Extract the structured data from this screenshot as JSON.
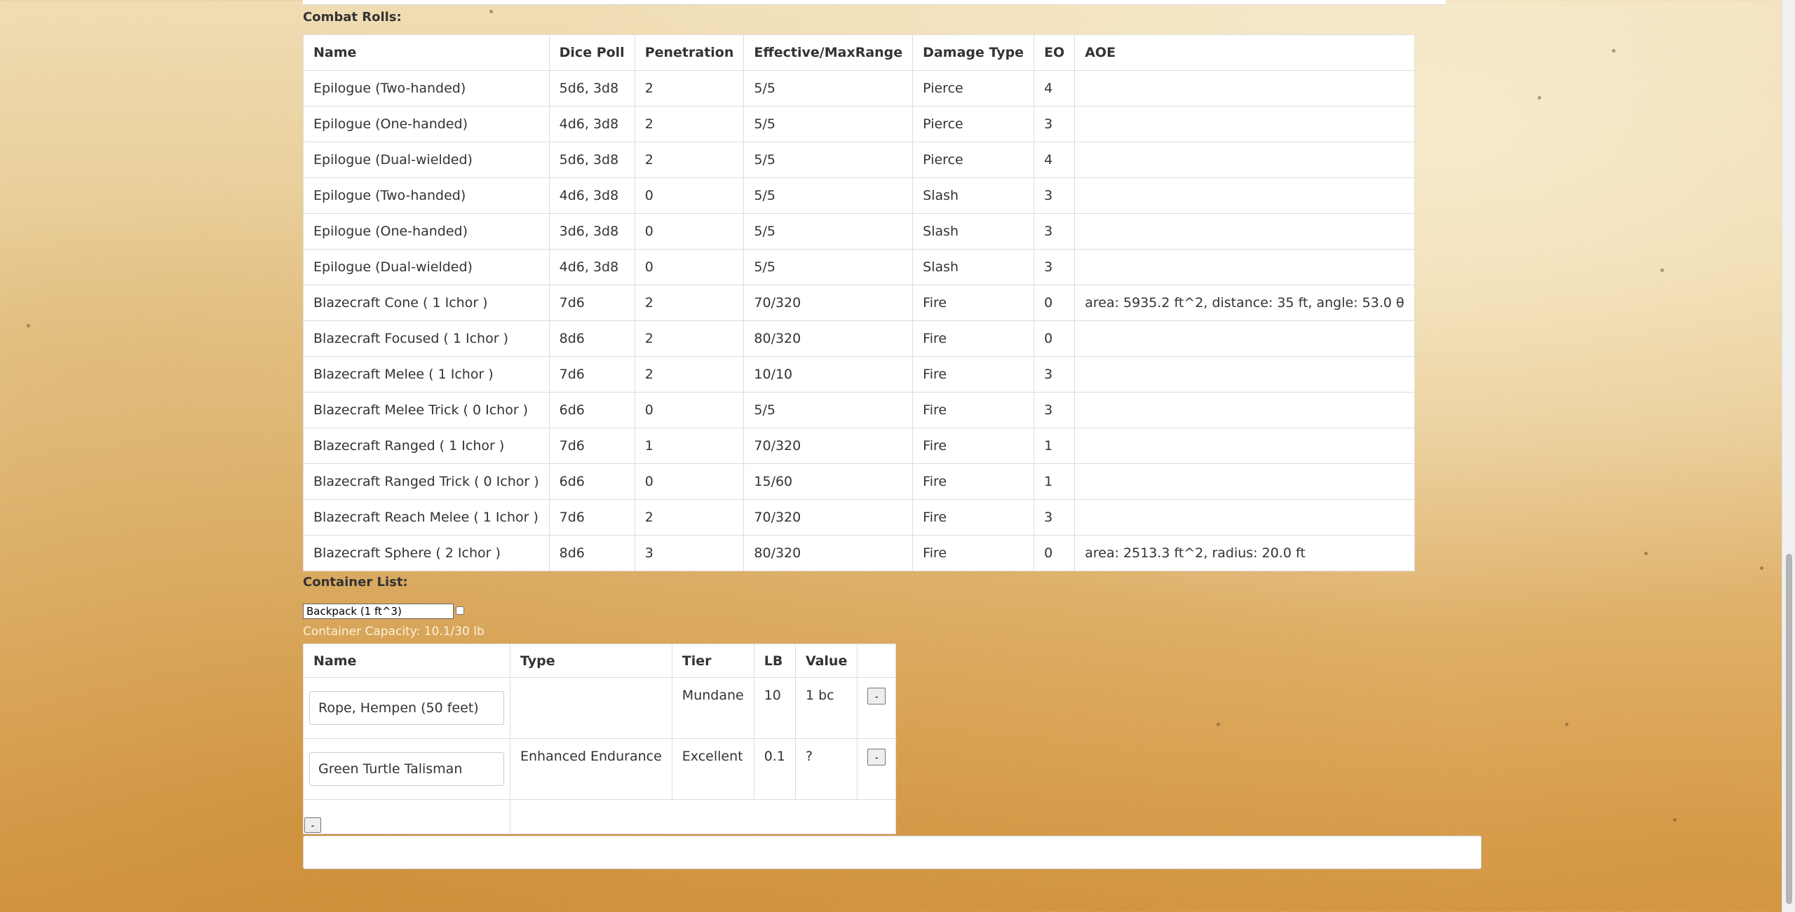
{
  "combat": {
    "label": "Combat Rolls:",
    "headers": [
      "Name",
      "Dice Poll",
      "Penetration",
      "Effective/MaxRange",
      "Damage Type",
      "EO",
      "AOE"
    ],
    "rows": [
      [
        "Epilogue (Two-handed)",
        "5d6, 3d8",
        "2",
        "5/5",
        "Pierce",
        "4",
        ""
      ],
      [
        "Epilogue (One-handed)",
        "4d6, 3d8",
        "2",
        "5/5",
        "Pierce",
        "3",
        ""
      ],
      [
        "Epilogue (Dual-wielded)",
        "5d6, 3d8",
        "2",
        "5/5",
        "Pierce",
        "4",
        ""
      ],
      [
        "Epilogue (Two-handed)",
        "4d6, 3d8",
        "0",
        "5/5",
        "Slash",
        "3",
        ""
      ],
      [
        "Epilogue (One-handed)",
        "3d6, 3d8",
        "0",
        "5/5",
        "Slash",
        "3",
        ""
      ],
      [
        "Epilogue (Dual-wielded)",
        "4d6, 3d8",
        "0",
        "5/5",
        "Slash",
        "3",
        ""
      ],
      [
        "Blazecraft Cone ( 1 Ichor )",
        "7d6",
        "2",
        "70/320",
        "Fire",
        "0",
        "area: 5935.2 ft^2, distance: 35 ft, angle: 53.0 θ"
      ],
      [
        "Blazecraft Focused ( 1 Ichor )",
        "8d6",
        "2",
        "80/320",
        "Fire",
        "0",
        ""
      ],
      [
        "Blazecraft Melee ( 1 Ichor )",
        "7d6",
        "2",
        "10/10",
        "Fire",
        "3",
        ""
      ],
      [
        "Blazecraft Melee Trick ( 0 Ichor )",
        "6d6",
        "0",
        "5/5",
        "Fire",
        "3",
        ""
      ],
      [
        "Blazecraft Ranged ( 1 Ichor )",
        "7d6",
        "1",
        "70/320",
        "Fire",
        "1",
        ""
      ],
      [
        "Blazecraft Ranged Trick ( 0 Ichor )",
        "6d6",
        "0",
        "15/60",
        "Fire",
        "1",
        ""
      ],
      [
        "Blazecraft Reach Melee ( 1 Ichor )",
        "7d6",
        "2",
        "70/320",
        "Fire",
        "3",
        ""
      ],
      [
        "Blazecraft Sphere ( 2 Ichor )",
        "8d6",
        "3",
        "80/320",
        "Fire",
        "0",
        "area: 2513.3 ft^2, radius: 20.0 ft"
      ]
    ]
  },
  "containers": {
    "label": "Container List:",
    "selected": "Backpack (1 ft^3)",
    "capacity": "Container Capacity: 10.1/30 lb",
    "headers": [
      "Name",
      "Type",
      "Tier",
      "LB",
      "Value",
      ""
    ],
    "items": [
      {
        "name": "Rope, Hempen (50 feet)",
        "type": "",
        "tier": "Mundane",
        "lb": "10",
        "value": "1 bc",
        "remove": "-"
      },
      {
        "name": "Green Turtle Talisman",
        "type": "Enhanced Endurance",
        "tier": "Excellent",
        "lb": "0.1",
        "value": "?",
        "remove": "-"
      }
    ],
    "remove_container": "-"
  },
  "colors": {
    "background": "#e8c98d",
    "table_bg": "#ffffff",
    "border": "#dddddd",
    "capacity_text": "#fdf2d8"
  }
}
